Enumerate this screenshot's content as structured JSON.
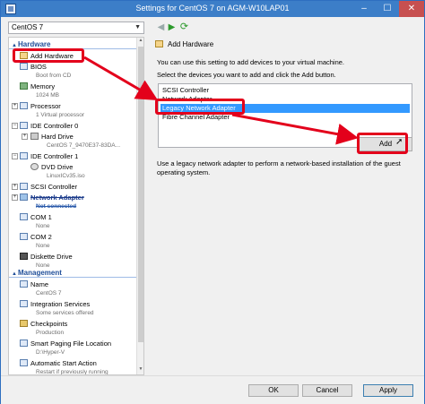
{
  "window": {
    "title": "Settings for CentOS 7 on AGM-W10LAP01"
  },
  "titlebar": {
    "min": "–",
    "max": "☐",
    "close": "✕"
  },
  "vm_selector": {
    "value": "CentOS 7"
  },
  "nav": {
    "back": "◀",
    "forward": "▶",
    "refresh": "⟳"
  },
  "left": {
    "hardware_header": "Hardware",
    "management_header": "Management",
    "hardware_items": [
      {
        "label": "Add Hardware",
        "sub": ""
      },
      {
        "label": "BIOS",
        "sub": "Boot from CD"
      },
      {
        "label": "Memory",
        "sub": "1024 MB"
      },
      {
        "label": "Processor",
        "sub": "1 Virtual processor"
      },
      {
        "label": "IDE Controller 0",
        "sub": ""
      },
      {
        "label": "Hard Drive",
        "sub": "CentOS 7_9470E37-83DA..."
      },
      {
        "label": "IDE Controller 1",
        "sub": ""
      },
      {
        "label": "DVD Drive",
        "sub": "LinuxICv35.iso"
      },
      {
        "label": "SCSI Controller",
        "sub": ""
      },
      {
        "label": "Network Adapter",
        "sub": "Not connected"
      },
      {
        "label": "COM 1",
        "sub": "None"
      },
      {
        "label": "COM 2",
        "sub": "None"
      },
      {
        "label": "Diskette Drive",
        "sub": "None"
      }
    ],
    "management_items": [
      {
        "label": "Name",
        "sub": "CentOS 7"
      },
      {
        "label": "Integration Services",
        "sub": "Some services offered"
      },
      {
        "label": "Checkpoints",
        "sub": "Production"
      },
      {
        "label": "Smart Paging File Location",
        "sub": "D:\\Hyper-V"
      },
      {
        "label": "Automatic Start Action",
        "sub": "Restart if previously running"
      }
    ]
  },
  "right": {
    "header": "Add Hardware",
    "intro": "You can use this setting to add devices to your virtual machine.",
    "instruction": "Select the devices you want to add and click the Add button.",
    "devices": [
      "SCSI Controller",
      "Network Adapter",
      "Legacy Network Adapter",
      "Fibre Channel Adapter"
    ],
    "selected_device": "Legacy Network Adapter",
    "add_button": "Add",
    "description": "Use a legacy network adapter to perform a network-based installation of the guest operating system."
  },
  "bottom": {
    "ok": "OK",
    "cancel": "Cancel",
    "apply": "Apply"
  },
  "colors": {
    "titlebar": "#3c7ec8",
    "selection": "#3399ff",
    "annotation": "#e3001b",
    "section_header": "#1f4e99"
  }
}
